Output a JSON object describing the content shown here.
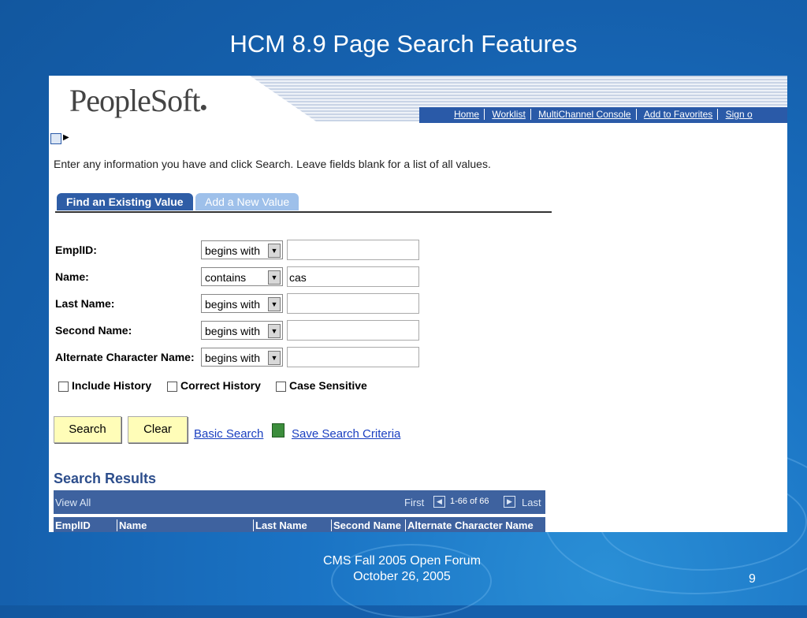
{
  "slide": {
    "title": "HCM 8.9 Page Search Features",
    "footer_line1": "CMS Fall 2005 Open Forum",
    "footer_line2": "October 26, 2005",
    "page_number": "9"
  },
  "app": {
    "logo": "PeopleSoft",
    "nav": [
      "Home",
      "Worklist",
      "MultiChannel Console",
      "Add to Favorites",
      "Sign o"
    ],
    "instructions": "Enter any information you have and click Search. Leave fields blank for a list of all values.",
    "tabs": {
      "active": "Find an Existing Value",
      "inactive": "Add a New Value"
    },
    "fields": [
      {
        "label": "EmplID:",
        "operator": "begins with",
        "value": ""
      },
      {
        "label": "Name:",
        "operator": "contains",
        "value": "cas"
      },
      {
        "label": "Last Name:",
        "operator": "begins with",
        "value": ""
      },
      {
        "label": "Second Name:",
        "operator": "begins with",
        "value": ""
      },
      {
        "label": "Alternate Character Name:",
        "operator": "begins with",
        "value": ""
      }
    ],
    "checkboxes": [
      "Include History",
      "Correct History",
      "Case Sensitive"
    ],
    "buttons": {
      "search": "Search",
      "clear": "Clear"
    },
    "links": {
      "basic_search": "Basic Search",
      "save_criteria": "Save Search Criteria"
    },
    "results": {
      "title": "Search Results",
      "view_all": "View All",
      "first": "First",
      "range": "1-66 of 66",
      "last": "Last",
      "columns": [
        "EmplID",
        "Name",
        "Last Name",
        "Second Name",
        "Alternate Character Name"
      ]
    }
  }
}
